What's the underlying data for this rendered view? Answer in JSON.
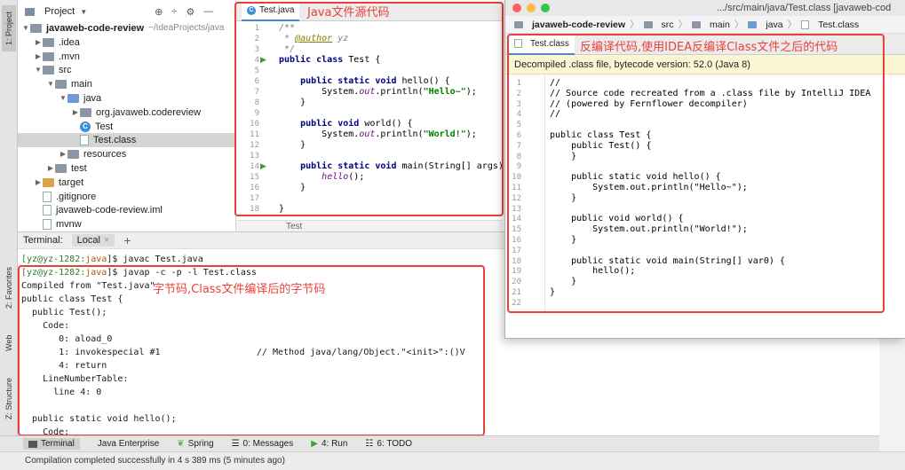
{
  "left_strip": {
    "tabs": [
      "1: Project",
      "2: Favorites",
      "Web",
      "Z: Structure"
    ]
  },
  "project": {
    "title": "Project",
    "tree": [
      {
        "label": "javaweb-code-review",
        "suffix": "~/IdeaProjects/java",
        "depth": 0,
        "arrow": "▼",
        "icon": "module",
        "bold": true
      },
      {
        "label": ".idea",
        "depth": 1,
        "arrow": "▶",
        "icon": "folder"
      },
      {
        "label": ".mvn",
        "depth": 1,
        "arrow": "▶",
        "icon": "folder"
      },
      {
        "label": "src",
        "depth": 1,
        "arrow": "▼",
        "icon": "folder"
      },
      {
        "label": "main",
        "depth": 2,
        "arrow": "▼",
        "icon": "folder"
      },
      {
        "label": "java",
        "depth": 3,
        "arrow": "▼",
        "icon": "folder-blue"
      },
      {
        "label": "org.javaweb.codereview",
        "depth": 4,
        "arrow": "▶",
        "icon": "package"
      },
      {
        "label": "Test",
        "depth": 4,
        "arrow": "",
        "icon": "class"
      },
      {
        "label": "Test.class",
        "depth": 4,
        "arrow": "",
        "icon": "file",
        "selected": true
      },
      {
        "label": "resources",
        "depth": 3,
        "arrow": "▶",
        "icon": "folder"
      },
      {
        "label": "test",
        "depth": 2,
        "arrow": "▶",
        "icon": "folder"
      },
      {
        "label": "target",
        "depth": 1,
        "arrow": "▶",
        "icon": "folder-orange"
      },
      {
        "label": ".gitignore",
        "depth": 1,
        "arrow": "",
        "icon": "file"
      },
      {
        "label": "javaweb-code-review.iml",
        "depth": 1,
        "arrow": "",
        "icon": "file"
      },
      {
        "label": "mvnw",
        "depth": 1,
        "arrow": "",
        "icon": "file"
      }
    ]
  },
  "editor": {
    "tab_label": "Test.java",
    "annotation": "Java文件源代码",
    "footer": "Test",
    "lines": [
      {
        "n": "1",
        "html": "<span class='cm'>/**</span>"
      },
      {
        "n": "2",
        "html": "<span class='cm'> * <span class='anno'>@author</span> yz</span>"
      },
      {
        "n": "3",
        "html": "<span class='cm'> */</span>"
      },
      {
        "n": "4",
        "html": "<span class='kw'>public class</span> Test {",
        "run": true
      },
      {
        "n": "5",
        "html": ""
      },
      {
        "n": "6",
        "html": "    <span class='kw'>public static void</span> hello() {"
      },
      {
        "n": "7",
        "html": "        System.<span class='it'>out</span>.println(<span class='str'>\"Hello~\"</span>);"
      },
      {
        "n": "8",
        "html": "    }"
      },
      {
        "n": "9",
        "html": ""
      },
      {
        "n": "10",
        "html": "    <span class='kw'>public void</span> world() {"
      },
      {
        "n": "11",
        "html": "        System.<span class='it'>out</span>.println(<span class='str'>\"World!\"</span>);"
      },
      {
        "n": "12",
        "html": "    }"
      },
      {
        "n": "13",
        "html": ""
      },
      {
        "n": "14",
        "html": "    <span class='kw'>public static void</span> main(String[] args) {",
        "run": true
      },
      {
        "n": "15",
        "html": "        <span class='it'>hello</span>();"
      },
      {
        "n": "16",
        "html": "    }"
      },
      {
        "n": "17",
        "html": ""
      },
      {
        "n": "18",
        "html": "}"
      }
    ]
  },
  "terminal": {
    "title": "Terminal:",
    "tab_label": "Local",
    "annotation": "字节码,Class文件编译后的字节码",
    "lines": [
      {
        "prompt": "[yz@yz-1282:",
        "dir": "java",
        "end": "]$ ",
        "cmd": "javac Test.java"
      },
      {
        "prompt": "[yz@yz-1282:",
        "dir": "java",
        "end": "]$ ",
        "cmd": "javap -c -p -l Test.class"
      },
      {
        "text": "Compiled from \"Test.java\""
      },
      {
        "text": "public class Test {"
      },
      {
        "text": "  public Test();"
      },
      {
        "text": "    Code:"
      },
      {
        "text": "       0: aload_0"
      },
      {
        "text": "       1: invokespecial #1                  // Method java/lang/Object.\"<init>\":()V"
      },
      {
        "text": "       4: return"
      },
      {
        "text": "    LineNumberTable:"
      },
      {
        "text": "      line 4: 0"
      },
      {
        "text": ""
      },
      {
        "text": "  public static void hello();"
      },
      {
        "text": "    Code:"
      }
    ]
  },
  "bottom_tabs": [
    "Terminal",
    "Java Enterprise",
    "Spring",
    "0: Messages",
    "4: Run",
    "6: TODO"
  ],
  "status": "Compilation completed successfully in 4 s 389 ms (5 minutes ago)",
  "decompiled": {
    "window_title": ".../src/main/java/Test.class [javaweb-cod",
    "breadcrumb": [
      "javaweb-code-review",
      "src",
      "main",
      "java",
      "Test.class"
    ],
    "tab_label": "Test.class",
    "annotation": "反编译代码,使用IDEA反编译Class文件之后的代码",
    "notice": "Decompiled .class file, bytecode version: 52.0 (Java 8)",
    "lines": [
      {
        "n": "1",
        "t": "//"
      },
      {
        "n": "2",
        "t": "// Source code recreated from a .class file by IntelliJ IDEA"
      },
      {
        "n": "3",
        "t": "// (powered by Fernflower decompiler)"
      },
      {
        "n": "4",
        "t": "//"
      },
      {
        "n": "5",
        "t": ""
      },
      {
        "n": "6",
        "t": "public class Test {"
      },
      {
        "n": "7",
        "t": "    public Test() {"
      },
      {
        "n": "8",
        "t": "    }"
      },
      {
        "n": "9",
        "t": ""
      },
      {
        "n": "10",
        "t": "    public static void hello() {"
      },
      {
        "n": "11",
        "t": "        System.out.println(\"Hello~\");"
      },
      {
        "n": "12",
        "t": "    }"
      },
      {
        "n": "13",
        "t": ""
      },
      {
        "n": "14",
        "t": "    public void world() {"
      },
      {
        "n": "15",
        "t": "        System.out.println(\"World!\");"
      },
      {
        "n": "16",
        "t": "    }"
      },
      {
        "n": "17",
        "t": ""
      },
      {
        "n": "18",
        "t": "    public static void main(String[] var0) {"
      },
      {
        "n": "19",
        "t": "        hello();"
      },
      {
        "n": "20",
        "t": "    }"
      },
      {
        "n": "21",
        "t": "}"
      },
      {
        "n": "22",
        "t": ""
      }
    ]
  },
  "colors": {
    "annotation_red": "#e8413a",
    "notice_bg": "#fdf6d5",
    "selection": "#d4d4d4"
  }
}
